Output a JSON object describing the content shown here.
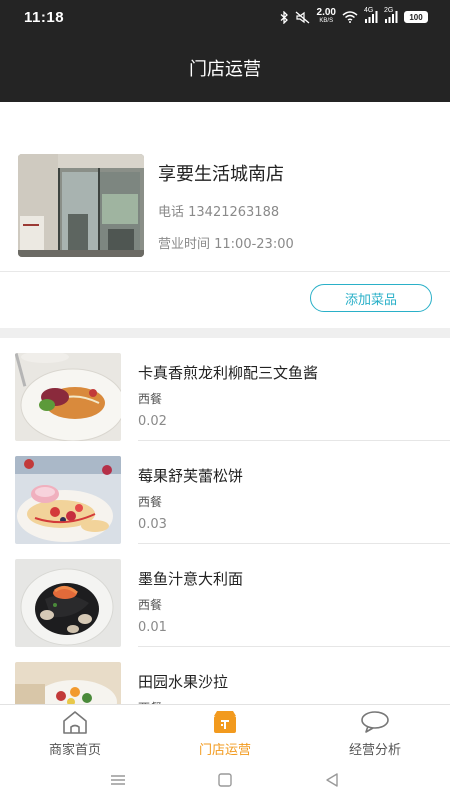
{
  "status_bar": {
    "time": "11:18",
    "speed_value": "2.00",
    "speed_unit": "KB/S",
    "net1": "4G",
    "net2": "2G",
    "battery": "100"
  },
  "header": {
    "title": "门店运营"
  },
  "store": {
    "name": "享要生活城南店",
    "phone": "电话 13421263188",
    "hours": "营业时间 11:00-23:00",
    "add_dish_label": "添加菜品"
  },
  "dishes": [
    {
      "name": "卡真香煎龙利柳配三文鱼酱",
      "category": "西餐",
      "price": "0.02"
    },
    {
      "name": "莓果舒芙蕾松饼",
      "category": "西餐",
      "price": "0.03"
    },
    {
      "name": "墨鱼汁意大利面",
      "category": "西餐",
      "price": "0.01"
    },
    {
      "name": "田园水果沙拉",
      "category": "西餐",
      "price": ""
    }
  ],
  "tabs": [
    {
      "label": "商家首页",
      "icon": "home-icon"
    },
    {
      "label": "门店运营",
      "icon": "store-icon"
    },
    {
      "label": "经营分析",
      "icon": "chat-bubble-icon"
    }
  ],
  "colors": {
    "header_bg": "#242424",
    "accent": "#2ab0c8",
    "active_tab": "#f29a1e"
  }
}
